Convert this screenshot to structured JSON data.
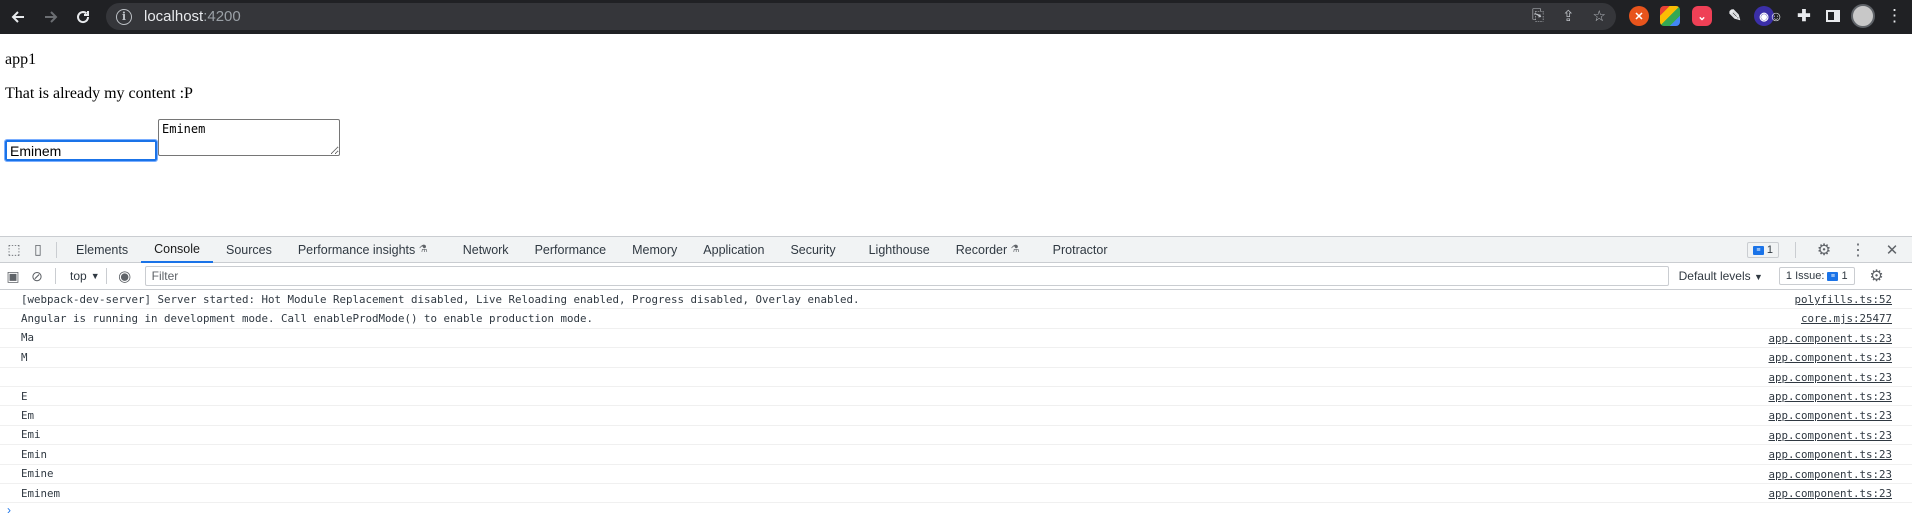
{
  "browser": {
    "url_host": "localhost",
    "url_port": ":4200",
    "colors": {
      "toolbar": "#202124",
      "omnibox": "#35363a"
    }
  },
  "page": {
    "title": "app1",
    "content": "That is already my content :P",
    "input_value": "Eminem",
    "textarea_value": "Eminem"
  },
  "devtools": {
    "tabs": [
      "Elements",
      "Console",
      "Sources",
      "Performance insights",
      "Network",
      "Performance",
      "Memory",
      "Application",
      "Security",
      "Lighthouse",
      "Recorder",
      "Protractor"
    ],
    "active_tab": "Console",
    "message_count": "1",
    "context": "top",
    "filter_placeholder": "Filter",
    "levels": "Default levels",
    "issues_label": "1 Issue:",
    "issues_count": "1",
    "accent": "#1a73e8"
  },
  "console": [
    {
      "msg": "[webpack-dev-server] Server started: Hot Module Replacement disabled, Live Reloading enabled, Progress disabled, Overlay enabled.",
      "src": "polyfills.ts:52"
    },
    {
      "msg": "Angular is running in development mode. Call enableProdMode() to enable production mode.",
      "src": "core.mjs:25477"
    },
    {
      "msg": "Ma",
      "src": "app.component.ts:23"
    },
    {
      "msg": "M",
      "src": "app.component.ts:23"
    },
    {
      "msg": "",
      "src": "app.component.ts:23"
    },
    {
      "msg": "E",
      "src": "app.component.ts:23"
    },
    {
      "msg": "Em",
      "src": "app.component.ts:23"
    },
    {
      "msg": "Emi",
      "src": "app.component.ts:23"
    },
    {
      "msg": "Emin",
      "src": "app.component.ts:23"
    },
    {
      "msg": "Emine",
      "src": "app.component.ts:23"
    },
    {
      "msg": "Eminem",
      "src": "app.component.ts:23"
    }
  ]
}
